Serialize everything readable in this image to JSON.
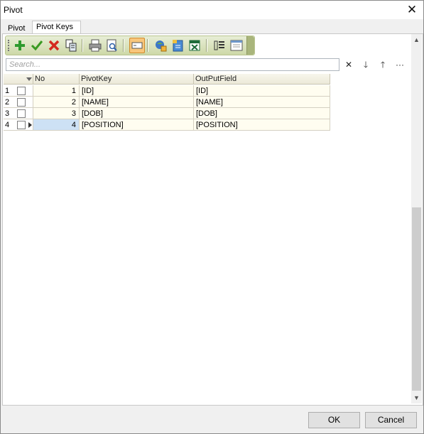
{
  "window": {
    "title": "Pivot"
  },
  "tabs": [
    {
      "label": "Pivot"
    },
    {
      "label": "Pivot Keys"
    }
  ],
  "toolbar": {
    "buttons": [
      {
        "icon": "add-icon"
      },
      {
        "icon": "check-icon"
      },
      {
        "icon": "delete-icon"
      },
      {
        "icon": "copy-icon"
      },
      {
        "icon": "print-icon"
      },
      {
        "icon": "print-preview-icon"
      },
      {
        "icon": "filter-row-icon"
      },
      {
        "icon": "export-icon"
      },
      {
        "icon": "export-xml-icon"
      },
      {
        "icon": "export-excel-icon"
      },
      {
        "icon": "columns-icon"
      },
      {
        "icon": "layout-icon"
      }
    ]
  },
  "search": {
    "placeholder": "Search..."
  },
  "grid": {
    "columns": [
      "No",
      "PivotKey",
      "OutPutField"
    ],
    "rows": [
      {
        "rownum": "1",
        "no": "1",
        "pivot_key": "[ID]",
        "output_field": "[ID]"
      },
      {
        "rownum": "2",
        "no": "2",
        "pivot_key": "[NAME]",
        "output_field": "[NAME]"
      },
      {
        "rownum": "3",
        "no": "3",
        "pivot_key": "[DOB]",
        "output_field": "[DOB]"
      },
      {
        "rownum": "4",
        "no": "4",
        "pivot_key": "[POSITION]",
        "output_field": "[POSITION]"
      }
    ]
  },
  "footer": {
    "ok_label": "OK",
    "cancel_label": "Cancel"
  }
}
